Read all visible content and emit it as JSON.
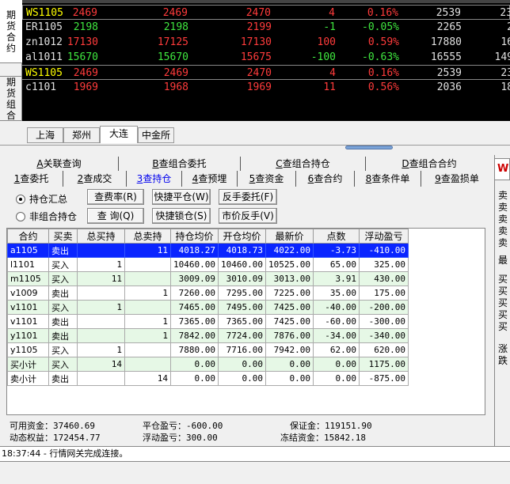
{
  "side_tabs": [
    {
      "label": [
        "期",
        "货",
        "合",
        "约"
      ],
      "active": true
    },
    {
      "label": [
        "期",
        "货",
        "组",
        "合"
      ],
      "active": false
    }
  ],
  "quotes": [
    {
      "symbol": "WS1105",
      "last": "2469",
      "bid": "2469",
      "ask": "2470",
      "change": "4",
      "pct": "0.16%",
      "volume": "2539",
      "extra": "23",
      "style": "selected"
    },
    {
      "symbol": "ER1105",
      "last": "2198",
      "bid": "2198",
      "ask": "2199",
      "change": "-1",
      "pct": "-0.05%",
      "volume": "2265",
      "extra": "2",
      "style": "normal"
    },
    {
      "symbol": "zn1012",
      "last": "17130",
      "bid": "17125",
      "ask": "17130",
      "change": "100",
      "pct": "0.59%",
      "volume": "17880",
      "extra": "16",
      "style": "normal"
    },
    {
      "symbol": "al1011",
      "last": "15670",
      "bid": "15670",
      "ask": "15675",
      "change": "-100",
      "pct": "-0.63%",
      "volume": "16555",
      "extra": "149",
      "style": "normal"
    },
    {
      "symbol": "WS1105",
      "last": "2469",
      "bid": "2469",
      "ask": "2470",
      "change": "4",
      "pct": "0.16%",
      "volume": "2539",
      "extra": "23",
      "style": "boxed"
    },
    {
      "symbol": "c1101",
      "last": "1969",
      "bid": "1968",
      "ask": "1969",
      "change": "11",
      "pct": "0.56%",
      "volume": "2036",
      "extra": "18",
      "style": "normal"
    }
  ],
  "exchange_tabs": [
    {
      "label": "上海",
      "active": false
    },
    {
      "label": "郑州",
      "active": false
    },
    {
      "label": "大连",
      "active": true
    },
    {
      "label": "中金所",
      "active": false
    }
  ],
  "top_tabs": [
    {
      "key": "A",
      "label": "关联查询"
    },
    {
      "key": "B",
      "label": "查组合委托"
    },
    {
      "key": "C",
      "label": "查组合持仓"
    },
    {
      "key": "D",
      "label": "查组合合约"
    }
  ],
  "sub_tabs": [
    {
      "key": "1",
      "label": "查委托",
      "active": false
    },
    {
      "key": "2",
      "label": "查成交",
      "active": false
    },
    {
      "key": "3",
      "label": "查持仓",
      "active": true
    },
    {
      "key": "4",
      "label": "查预埋",
      "active": false
    },
    {
      "key": "5",
      "label": "查资金",
      "active": false
    },
    {
      "key": "6",
      "label": "查合约",
      "active": false
    },
    {
      "key": "8",
      "label": "查条件单",
      "active": false
    },
    {
      "key": "9",
      "label": "查盈损单",
      "active": false
    }
  ],
  "radios": [
    {
      "label": "持仓汇总",
      "checked": true
    },
    {
      "label": "非组合持仓",
      "checked": false
    }
  ],
  "buttons": {
    "fee_rate": "查费率(R)",
    "query": "查 询(Q)",
    "quick_close": "快捷平仓(W)",
    "quick_lock": "快捷锁仓(S)",
    "reverse_order": "反手委托(F)",
    "market_reverse": "市价反手(V)"
  },
  "table": {
    "headers": [
      "合约",
      "买卖",
      "总买持",
      "总卖持",
      "持仓均价",
      "开仓均价",
      "最新价",
      "点数",
      "浮动盈亏"
    ],
    "rows": [
      {
        "cells": [
          "a1105",
          "卖出",
          "",
          "11",
          "4018.27",
          "4018.73",
          "4022.00",
          "-3.73",
          "-410.00"
        ],
        "style": "hl"
      },
      {
        "cells": [
          "l1101",
          "买入",
          "1",
          "",
          "10460.00",
          "10460.00",
          "10525.00",
          "65.00",
          "325.00"
        ],
        "style": "w"
      },
      {
        "cells": [
          "m1105",
          "买入",
          "11",
          "",
          "3009.09",
          "3010.09",
          "3013.00",
          "3.91",
          "430.00"
        ],
        "style": "g"
      },
      {
        "cells": [
          "v1009",
          "卖出",
          "",
          "1",
          "7260.00",
          "7295.00",
          "7225.00",
          "35.00",
          "175.00"
        ],
        "style": "w"
      },
      {
        "cells": [
          "v1101",
          "买入",
          "1",
          "",
          "7465.00",
          "7495.00",
          "7425.00",
          "-40.00",
          "-200.00"
        ],
        "style": "g"
      },
      {
        "cells": [
          "v1101",
          "卖出",
          "",
          "1",
          "7365.00",
          "7365.00",
          "7425.00",
          "-60.00",
          "-300.00"
        ],
        "style": "w"
      },
      {
        "cells": [
          "y1101",
          "卖出",
          "",
          "1",
          "7842.00",
          "7724.00",
          "7876.00",
          "-34.00",
          "-340.00"
        ],
        "style": "g"
      },
      {
        "cells": [
          "y1105",
          "买入",
          "1",
          "",
          "7880.00",
          "7716.00",
          "7942.00",
          "62.00",
          "620.00"
        ],
        "style": "w"
      },
      {
        "cells": [
          "买小计",
          "买入",
          "14",
          "",
          "0.00",
          "0.00",
          "0.00",
          "0.00",
          "1175.00"
        ],
        "style": "g"
      },
      {
        "cells": [
          "卖小计",
          "卖出",
          "",
          "14",
          "0.00",
          "0.00",
          "0.00",
          "0.00",
          "-875.00"
        ],
        "style": "w"
      }
    ]
  },
  "summary": {
    "available_label": "可用资金：",
    "available": "37460.69",
    "dynamic_label": "动态权益：",
    "dynamic": "172454.77",
    "close_pl_label": "平仓盈亏：",
    "close_pl": "-600.00",
    "float_pl_label": "浮动盈亏：",
    "float_pl": "300.00",
    "margin_label": "保证金：",
    "margin": "119151.90",
    "frozen_label": "冻结资金：",
    "frozen": "15842.18"
  },
  "right_panel": {
    "top": "W",
    "items": [
      "卖",
      "卖",
      "卖",
      "卖",
      "卖",
      "最",
      "买",
      "买",
      "买",
      "买",
      "买",
      "涨",
      "跌"
    ]
  },
  "status_text": "18:37:44 - 行情网关完成连接。"
}
